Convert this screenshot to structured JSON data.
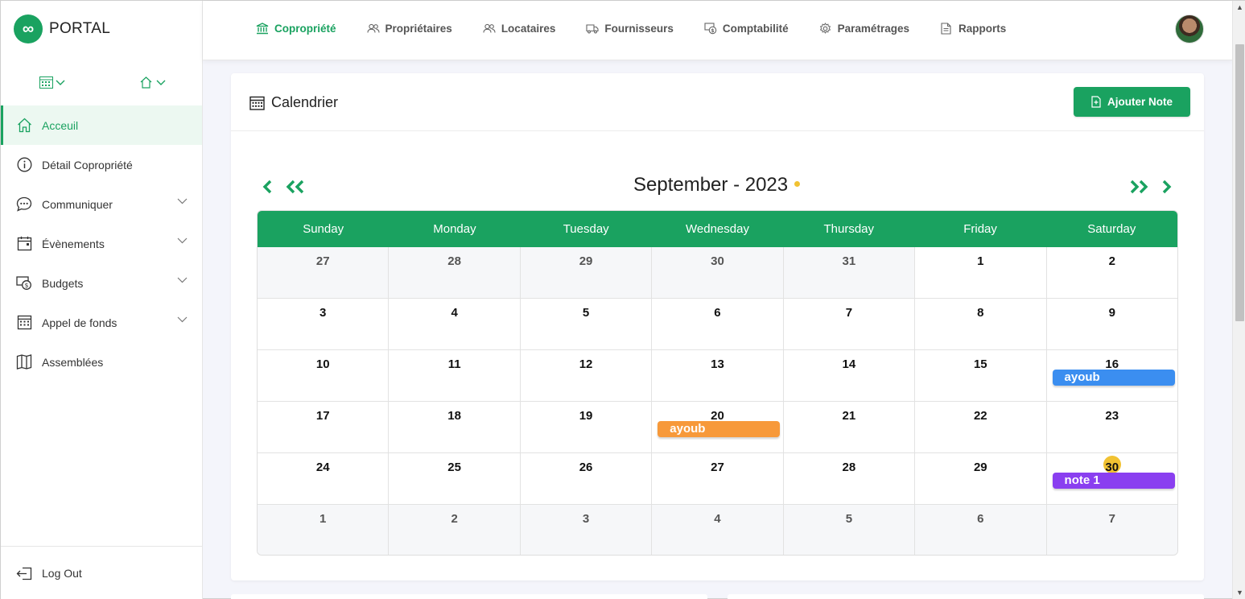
{
  "brand": {
    "logo": "∞",
    "name": "PORTAL"
  },
  "sidebar": {
    "switchers": [
      {
        "icon": "calendar-grid-icon"
      },
      {
        "icon": "home-icon"
      }
    ],
    "items": [
      {
        "label": "Acceuil",
        "icon": "home-icon",
        "active": true,
        "expandable": false
      },
      {
        "label": "Détail Copropriété",
        "icon": "info-icon",
        "active": false,
        "expandable": false
      },
      {
        "label": "Communiquer",
        "icon": "chat-icon",
        "active": false,
        "expandable": true
      },
      {
        "label": "Évènements",
        "icon": "calendar-icon",
        "active": false,
        "expandable": true
      },
      {
        "label": "Budgets",
        "icon": "money-icon",
        "active": false,
        "expandable": true
      },
      {
        "label": "Appel de fonds",
        "icon": "calendar-grid-icon",
        "active": false,
        "expandable": true
      },
      {
        "label": "Assemblées",
        "icon": "map-icon",
        "active": false,
        "expandable": false
      }
    ],
    "logout": {
      "label": "Log Out",
      "icon": "logout-icon"
    }
  },
  "topnav": [
    {
      "label": "Copropriété",
      "icon": "bank-icon",
      "active": true
    },
    {
      "label": "Propriétaires",
      "icon": "users-icon",
      "active": false
    },
    {
      "label": "Locataires",
      "icon": "users-icon",
      "active": false
    },
    {
      "label": "Fournisseurs",
      "icon": "truck-icon",
      "active": false
    },
    {
      "label": "Comptabilité",
      "icon": "accounting-icon",
      "active": false
    },
    {
      "label": "Paramétrages",
      "icon": "gear-icon",
      "active": false
    },
    {
      "label": "Rapports",
      "icon": "document-icon",
      "active": false
    }
  ],
  "card": {
    "title": "Calendrier",
    "add_button": "Ajouter Note"
  },
  "calendar": {
    "month_label": "September - 2023",
    "weekdays": [
      "Sunday",
      "Monday",
      "Tuesday",
      "Wednesday",
      "Thursday",
      "Friday",
      "Saturday"
    ],
    "weeks": [
      [
        {
          "d": "27",
          "other": true
        },
        {
          "d": "28",
          "other": true
        },
        {
          "d": "29",
          "other": true
        },
        {
          "d": "30",
          "other": true
        },
        {
          "d": "31",
          "other": true
        },
        {
          "d": "1"
        },
        {
          "d": "2"
        }
      ],
      [
        {
          "d": "3"
        },
        {
          "d": "4"
        },
        {
          "d": "5"
        },
        {
          "d": "6"
        },
        {
          "d": "7"
        },
        {
          "d": "8"
        },
        {
          "d": "9"
        }
      ],
      [
        {
          "d": "10"
        },
        {
          "d": "11"
        },
        {
          "d": "12"
        },
        {
          "d": "13"
        },
        {
          "d": "14"
        },
        {
          "d": "15"
        },
        {
          "d": "16",
          "event": {
            "label": "ayoub",
            "color": "#3b8ef0"
          }
        }
      ],
      [
        {
          "d": "17"
        },
        {
          "d": "18"
        },
        {
          "d": "19"
        },
        {
          "d": "20",
          "event": {
            "label": "ayoub",
            "color": "#f7993a"
          }
        },
        {
          "d": "21"
        },
        {
          "d": "22"
        },
        {
          "d": "23"
        }
      ],
      [
        {
          "d": "24"
        },
        {
          "d": "25"
        },
        {
          "d": "26"
        },
        {
          "d": "27"
        },
        {
          "d": "28"
        },
        {
          "d": "29"
        },
        {
          "d": "30",
          "today": true,
          "event": {
            "label": "note 1",
            "color": "#8a3ff0"
          }
        }
      ],
      [
        {
          "d": "1",
          "other": true
        },
        {
          "d": "2",
          "other": true
        },
        {
          "d": "3",
          "other": true
        },
        {
          "d": "4",
          "other": true
        },
        {
          "d": "5",
          "other": true
        },
        {
          "d": "6",
          "other": true
        },
        {
          "d": "7",
          "other": true
        }
      ]
    ]
  },
  "colors": {
    "accent": "#1aa260",
    "today": "#f1c232"
  }
}
